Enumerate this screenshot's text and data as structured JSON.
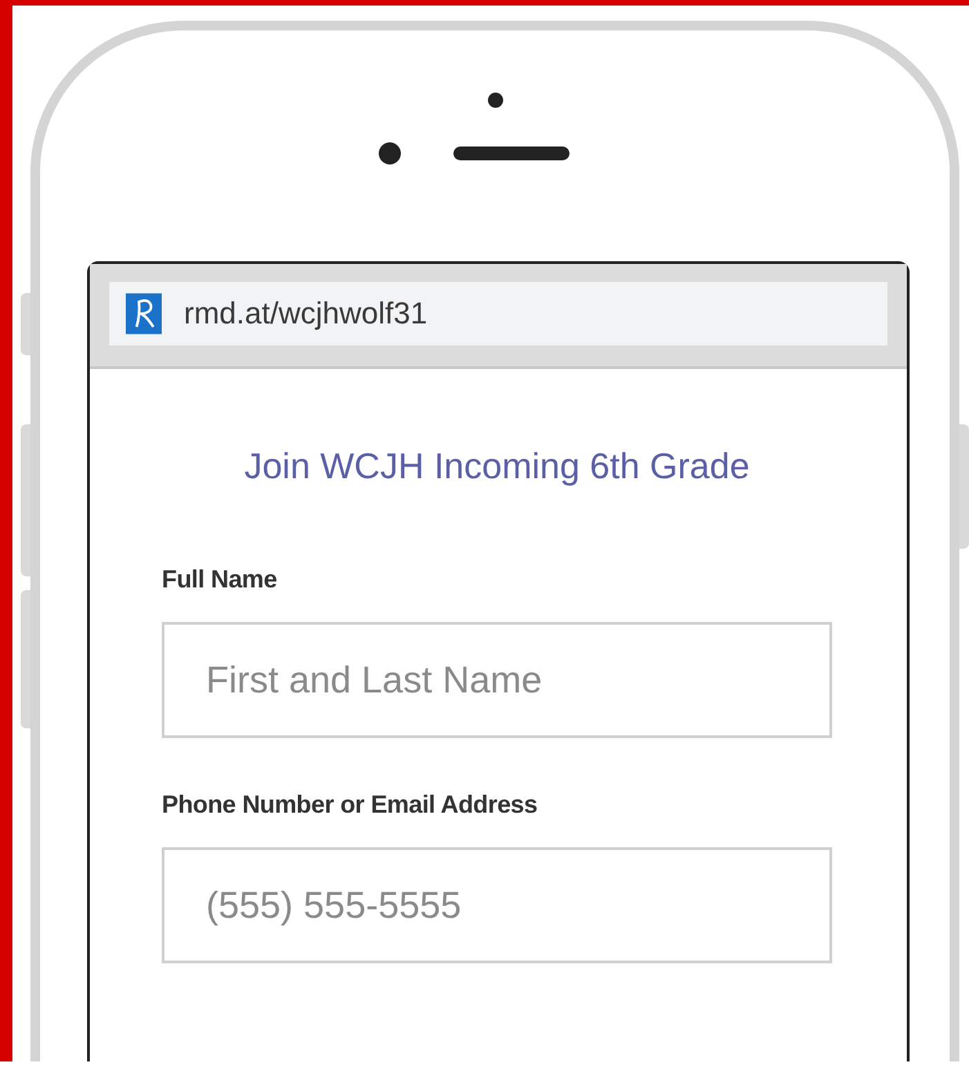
{
  "address_bar": {
    "url": "rmd.at/wcjhwolf31"
  },
  "form": {
    "title": "Join WCJH Incoming 6th Grade",
    "fields": [
      {
        "label": "Full Name",
        "placeholder": "First and Last Name"
      },
      {
        "label": "Phone Number or Email Address",
        "placeholder": "(555) 555-5555"
      }
    ]
  }
}
